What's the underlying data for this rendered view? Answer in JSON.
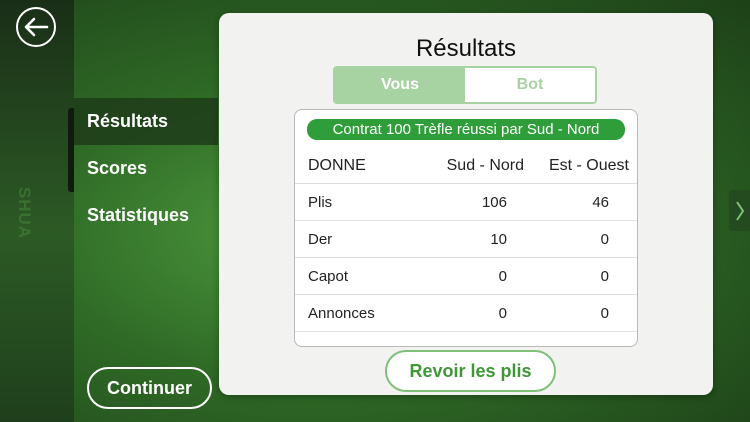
{
  "sidebar": {
    "side_label": "SHUA",
    "items": [
      {
        "label": "Résultats",
        "active": true
      },
      {
        "label": "Scores",
        "active": false
      },
      {
        "label": "Statistiques",
        "active": false
      }
    ],
    "continue_label": "Continuer"
  },
  "panel": {
    "title": "Résultats",
    "segments": [
      {
        "label": "Vous",
        "selected": true
      },
      {
        "label": "Bot",
        "selected": false
      }
    ],
    "contract": "Contrat 100 Trèfle réussi par Sud - Nord",
    "table": {
      "headers": [
        "DONNE",
        "Sud - Nord",
        "Est - Ouest"
      ],
      "rows": [
        [
          "Plis",
          "106",
          "46"
        ],
        [
          "Der",
          "10",
          "0"
        ],
        [
          "Capot",
          "0",
          "0"
        ],
        [
          "Annonces",
          "0",
          "0"
        ]
      ]
    },
    "review_label": "Revoir les plis"
  },
  "colors": {
    "accent_green": "#2f9d3a",
    "segment_green": "#a7d3a2",
    "background_green": "#2f6a26"
  },
  "icons": {
    "back": "arrow-left-icon",
    "next": "chevron-right-icon"
  }
}
